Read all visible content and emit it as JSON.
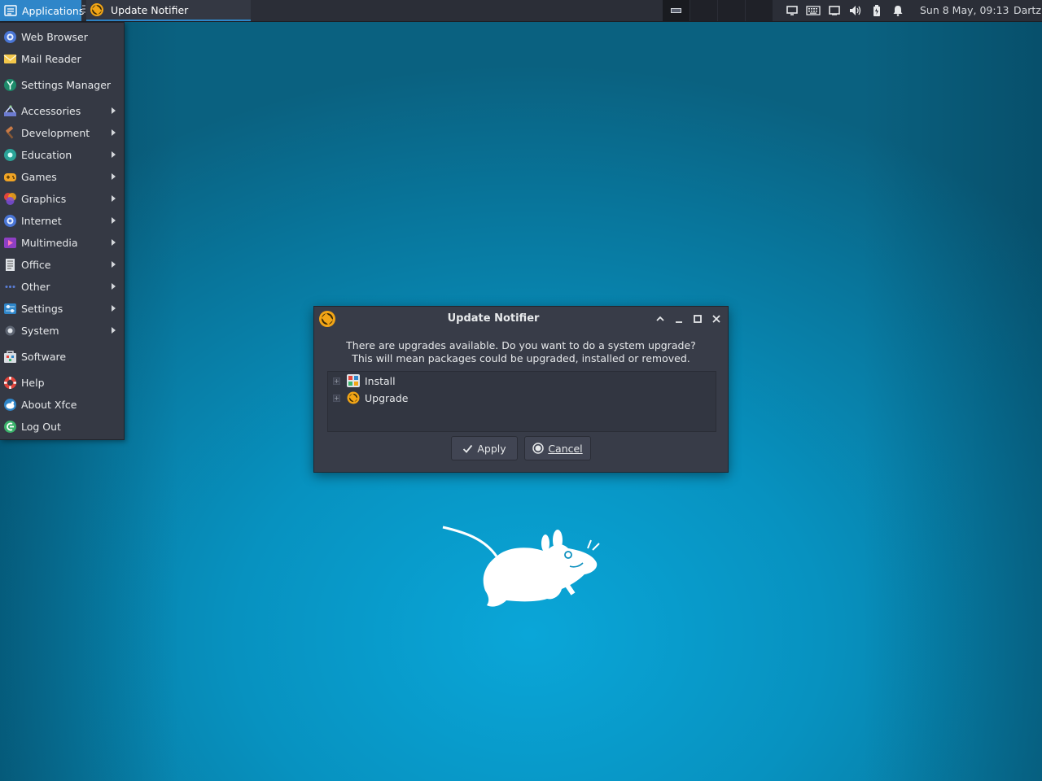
{
  "panel": {
    "applications_label": "Applications",
    "task_title": "Update Notifier",
    "clock": "Sun  8 May, 09:13",
    "user": "Dartz",
    "tray_icons": [
      "display-icon",
      "keyboard-icon",
      "screen-icon",
      "volume-icon",
      "battery-icon",
      "bell-icon"
    ]
  },
  "menu": {
    "items": [
      {
        "label": "Web Browser",
        "icon": "globe-icon",
        "submenu": false
      },
      {
        "label": "Mail Reader",
        "icon": "envelope-icon",
        "submenu": false
      },
      {
        "label": "Settings Manager",
        "icon": "settings-manager-icon",
        "submenu": false
      },
      {
        "label": "Accessories",
        "icon": "accessories-icon",
        "submenu": true
      },
      {
        "label": "Development",
        "icon": "hammer-icon",
        "submenu": true
      },
      {
        "label": "Education",
        "icon": "education-icon",
        "submenu": true
      },
      {
        "label": "Games",
        "icon": "gamepad-icon",
        "submenu": true
      },
      {
        "label": "Graphics",
        "icon": "graphics-icon",
        "submenu": true
      },
      {
        "label": "Internet",
        "icon": "globe-icon",
        "submenu": true
      },
      {
        "label": "Multimedia",
        "icon": "multimedia-icon",
        "submenu": true
      },
      {
        "label": "Office",
        "icon": "document-icon",
        "submenu": true
      },
      {
        "label": "Other",
        "icon": "dots-icon",
        "submenu": true
      },
      {
        "label": "Settings",
        "icon": "settings-icon",
        "submenu": true
      },
      {
        "label": "System",
        "icon": "gear-icon",
        "submenu": true
      },
      {
        "label": "Software",
        "icon": "software-icon",
        "submenu": false
      },
      {
        "label": "Help",
        "icon": "lifebuoy-icon",
        "submenu": false
      },
      {
        "label": "About Xfce",
        "icon": "xfce-mouse-icon",
        "submenu": false
      },
      {
        "label": "Log Out",
        "icon": "logout-icon",
        "submenu": false
      }
    ]
  },
  "dialog": {
    "title": "Update Notifier",
    "message_line1": "There are upgrades available. Do you want to do a system upgrade?",
    "message_line2": "This will mean packages could be upgraded, installed or removed.",
    "tree": [
      {
        "label": "Install",
        "icon": "install-package-icon"
      },
      {
        "label": "Upgrade",
        "icon": "update-icon"
      }
    ],
    "apply_label": "Apply",
    "cancel_label": "Cancel"
  },
  "colors": {
    "panel_bg": "#2b2e37",
    "accent": "#2f86c9",
    "menu_bg": "#353944",
    "dialog_bg": "#383c48",
    "desktop": "#0792c0"
  }
}
